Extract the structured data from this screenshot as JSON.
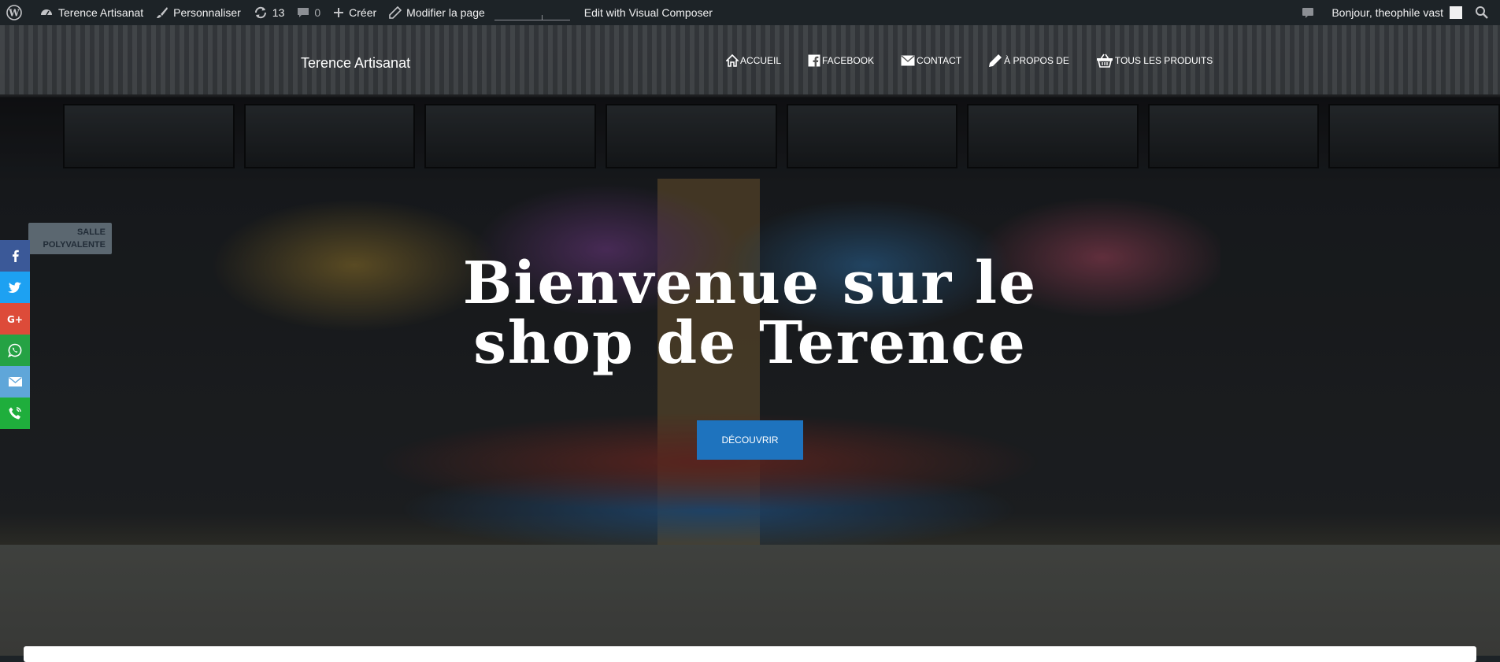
{
  "adminbar": {
    "site_name": "Terence Artisanat",
    "customize": "Personnaliser",
    "updates_count": "13",
    "comments_count": "0",
    "new": "Créer",
    "edit_page": "Modifier la page",
    "visual_composer": "Edit with Visual Composer",
    "greeting": "Bonjour, theophile vast"
  },
  "header": {
    "site_title": "Terence Artisanat",
    "nav": [
      {
        "label": "ACCUEIL",
        "icon": "home-icon"
      },
      {
        "label": "FACEBOOK",
        "icon": "facebook-icon"
      },
      {
        "label": "CONTACT",
        "icon": "envelope-icon"
      },
      {
        "label": "À PROPOS DE",
        "icon": "pencil-icon"
      },
      {
        "label": "TOUS LES PRODUITS",
        "icon": "basket-icon"
      }
    ]
  },
  "hero": {
    "title_line1": "Bienvenue sur le",
    "title_line2": "shop de Terence",
    "cta_label": "DÉCOUVRIR",
    "sign_line1": "SALLE",
    "sign_line2": "POLYVALENTE"
  },
  "share": [
    {
      "name": "facebook",
      "color": "#3b5998"
    },
    {
      "name": "twitter",
      "color": "#1da1f2"
    },
    {
      "name": "google-plus",
      "color": "#dd4b39"
    },
    {
      "name": "whatsapp",
      "color": "#25a244"
    },
    {
      "name": "email",
      "color": "#5fa6d9"
    },
    {
      "name": "phone",
      "color": "#1fae3c"
    }
  ],
  "colors": {
    "adminbar_bg": "#1d2327",
    "button_blue": "#1e73be"
  }
}
